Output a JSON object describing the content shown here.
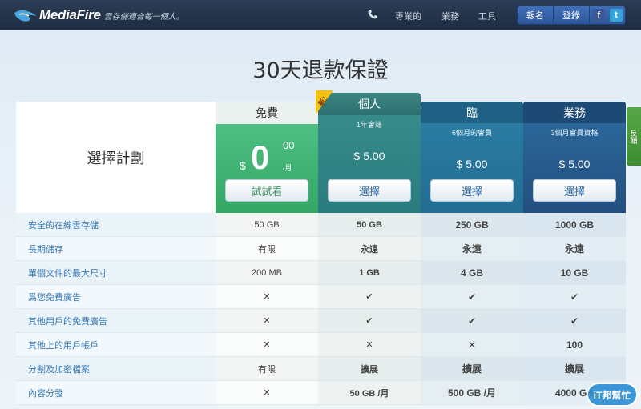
{
  "header": {
    "logo": "MediaFire",
    "tagline": "雲存儲適合每一個人。",
    "nav": [
      "專業的",
      "業務",
      "工具"
    ],
    "signup": "報名",
    "login": "登錄",
    "facebook": "f",
    "twitter": "t"
  },
  "headline": "30天退款保證",
  "table": {
    "label_head": "選擇計劃",
    "plans": {
      "free": {
        "name": "免費",
        "currency": "$",
        "price": "0",
        "cents": "00",
        "per": "/月",
        "button": "試試看"
      },
      "personal": {
        "badge": "新！",
        "name": "個人",
        "sub": "1年會籍",
        "price": "$ 5.00",
        "button": "選擇"
      },
      "pro": {
        "name": "臨",
        "sub": "6個月的會員",
        "price": "$ 5.00",
        "button": "選擇"
      },
      "business": {
        "name": "業務",
        "sub": "3個月會員資格",
        "price": "$ 5.00",
        "button": "選擇"
      }
    },
    "rows": [
      {
        "label": "安全的在線雲存儲",
        "v": [
          "50 GB",
          "50 GB",
          "250 GB",
          "1000 GB"
        ]
      },
      {
        "label": "長期儲存",
        "v": [
          "有限",
          "永遠",
          "永遠",
          "永遠"
        ]
      },
      {
        "label": "單個文件的最大尺寸",
        "v": [
          "200 MB",
          "1 GB",
          "4 GB",
          "10 GB"
        ]
      },
      {
        "label": "爲您免費廣告",
        "v": [
          "✕",
          "✔",
          "✔",
          "✔"
        ]
      },
      {
        "label": "其他用戶的免費廣告",
        "v": [
          "✕",
          "✔",
          "✔",
          "✔"
        ]
      },
      {
        "label": "其他上的用戶帳戶",
        "v": [
          "✕",
          "✕",
          "✕",
          "100"
        ]
      },
      {
        "label": "分割及加密檔案",
        "v": [
          "有限",
          "擴展",
          "擴展",
          "擴展"
        ]
      },
      {
        "label": "內容分發",
        "v": [
          "✕",
          "50 GB /月",
          "500 GB /月",
          "4000 GB"
        ]
      }
    ]
  },
  "feedback": "反饋",
  "watermark": "iT邦幫忙",
  "colors": {
    "free": "#35a765",
    "personal": "#2a7b7f",
    "pro": "#236d93",
    "business": "#234f7f",
    "nav": "#1e2d42"
  }
}
